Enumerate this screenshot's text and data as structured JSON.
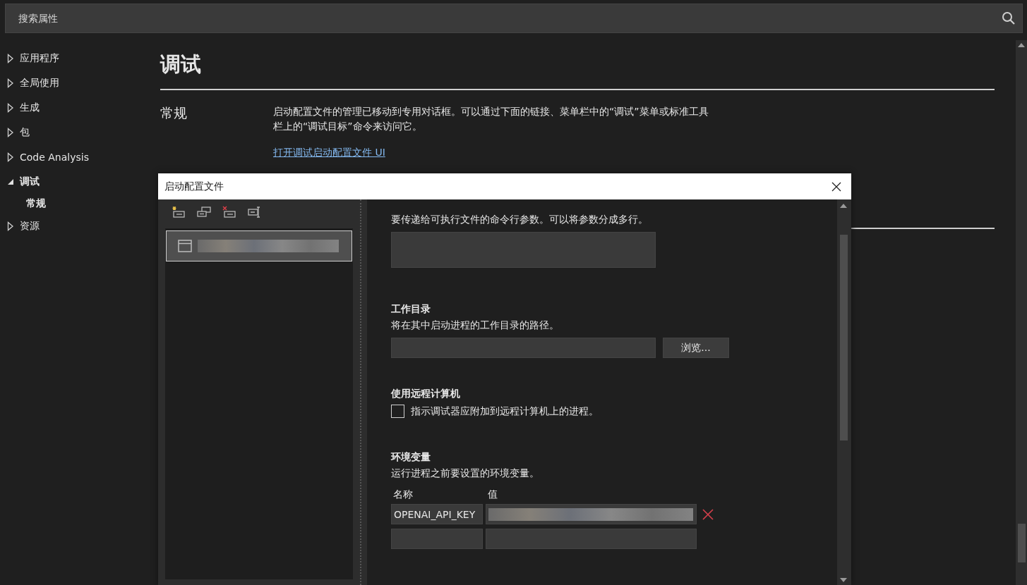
{
  "search": {
    "placeholder": "搜索属性"
  },
  "sidebar": {
    "items": [
      {
        "label": "应用程序",
        "expanded": false
      },
      {
        "label": "全局使用",
        "expanded": false
      },
      {
        "label": "生成",
        "expanded": false
      },
      {
        "label": "包",
        "expanded": false
      },
      {
        "label": "Code Analysis",
        "expanded": false
      },
      {
        "label": "调试",
        "expanded": true,
        "children": [
          {
            "label": "常规",
            "selected": true
          }
        ]
      },
      {
        "label": "资源",
        "expanded": false
      }
    ]
  },
  "page": {
    "title": "调试",
    "section": {
      "heading": "常规",
      "description": "启动配置文件的管理已移动到专用对话框。可以通过下面的链接、菜单栏中的“调试”菜单或标准工具栏上的“调试目标”命令来访问它。",
      "link": "打开调试启动配置文件 UI"
    }
  },
  "dialog": {
    "title": "启动配置文件",
    "profiles": [
      {
        "selected": true
      }
    ],
    "settings": [
      {
        "kind": "textarea",
        "description": "要传递给可执行文件的命令行参数。可以将参数分成多行。"
      },
      {
        "kind": "path",
        "heading": "工作目录",
        "description": "将在其中启动进程的工作目录的路径。",
        "button": "浏览..."
      },
      {
        "kind": "checkbox",
        "heading": "使用远程计算机",
        "label": "指示调试器应附加到远程计算机上的进程。",
        "checked": false
      },
      {
        "kind": "env",
        "heading": "环境变量",
        "description": "运行进程之前要设置的环境变量。",
        "name_header": "名称",
        "value_header": "值",
        "rows": [
          {
            "kind": "entry",
            "name": "OPENAI_API_KEY"
          },
          {
            "kind": "new"
          }
        ]
      }
    ]
  }
}
